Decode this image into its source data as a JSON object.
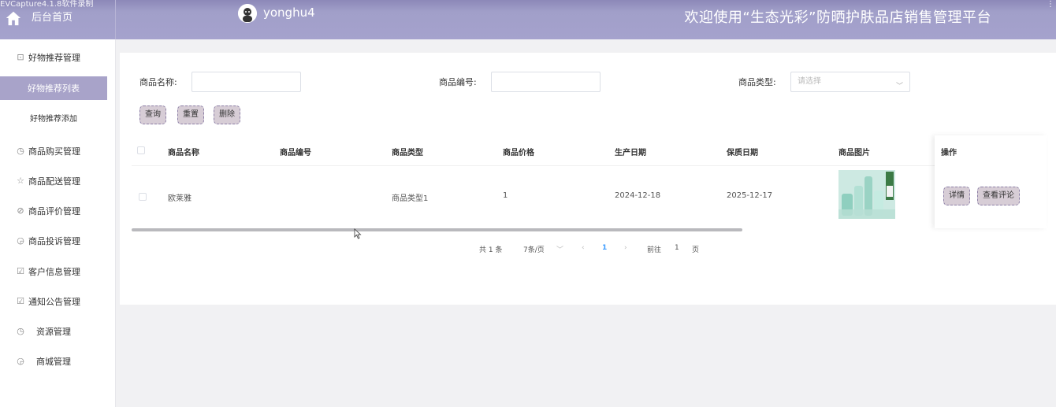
{
  "recording_label": "EVCapture4.1.8软件录制",
  "header": {
    "home_label": "后台首页",
    "username": "yonghu4",
    "site_title": "欢迎使用“生态光彩”防晒护肤品店销售管理平台"
  },
  "sidebar": {
    "items": [
      {
        "label": "好物推荐管理",
        "icon": "gift-icon"
      },
      {
        "label": "商品购买管理",
        "icon": "clock-icon"
      },
      {
        "label": "商品配送管理",
        "icon": "star-icon"
      },
      {
        "label": "商品评价管理",
        "icon": "compass-icon"
      },
      {
        "label": "商品投诉管理",
        "icon": "timer-icon"
      },
      {
        "label": "客户信息管理",
        "icon": "checkbox-icon"
      },
      {
        "label": "通知公告管理",
        "icon": "checkbox-icon"
      },
      {
        "label": "资源管理",
        "icon": "clock-icon"
      },
      {
        "label": "商城管理",
        "icon": "timer-icon"
      }
    ],
    "active_sub": "好物推荐列表",
    "sub_add": "好物推荐添加"
  },
  "search": {
    "name_label": "商品名称:",
    "code_label": "商品编号:",
    "type_label": "商品类型:",
    "type_placeholder": "请选择"
  },
  "buttons": {
    "query": "查询",
    "reset": "重置",
    "delete": "删除"
  },
  "table": {
    "headers": [
      "商品名称",
      "商品编号",
      "商品类型",
      "商品价格",
      "生产日期",
      "保质日期",
      "商品图片",
      "操作"
    ],
    "rows": [
      {
        "name": "欧莱雅",
        "code": "",
        "type": "商品类型1",
        "price": "1",
        "produced": "2024-12-18",
        "expires": "2025-12-17"
      }
    ],
    "ops": {
      "detail": "详情",
      "review": "查看评论"
    }
  },
  "pagination": {
    "total": "共 1 条",
    "page_size": "7条/页",
    "current": "1",
    "goto_label": "前往",
    "goto_value": "1",
    "page_unit": "页"
  },
  "colors": {
    "header_bg": "#a5a2cd",
    "active_bg": "#a8a3c9",
    "button_bg": "#d7cdd6",
    "pager_active": "#409eff"
  }
}
